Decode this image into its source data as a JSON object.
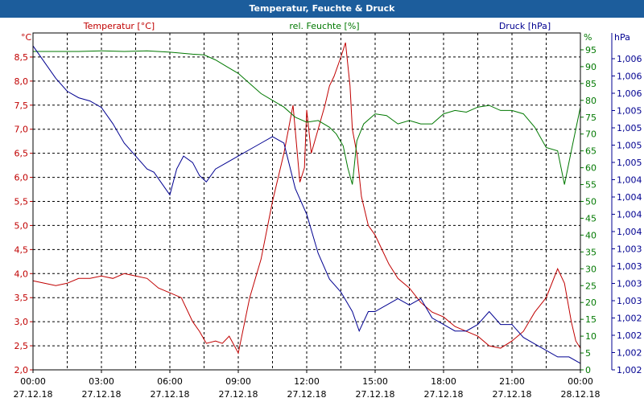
{
  "window": {
    "title": "Temperatur, Feuchte & Druck"
  },
  "colors": {
    "titlebar": "#1c5d9c",
    "temp": "#c00000",
    "hum": "#007800",
    "press": "#000090",
    "grid": "#000000"
  },
  "chart_data": {
    "type": "line",
    "x_ticks": [
      "00:00",
      "03:00",
      "06:00",
      "09:00",
      "12:00",
      "15:00",
      "18:00",
      "21:00",
      "00:00"
    ],
    "x_dates": [
      "27.12.18",
      "27.12.18",
      "27.12.18",
      "27.12.18",
      "27.12.18",
      "27.12.18",
      "27.12.18",
      "27.12.18",
      "28.12.18"
    ],
    "x_hours_range": [
      0,
      24
    ],
    "grid": true,
    "axes": {
      "temp": {
        "unit": "°C",
        "ylim": [
          2.0,
          9.0
        ],
        "ticks": [
          "2,0",
          "2,5",
          "3,0",
          "3,5",
          "4,0",
          "4,5",
          "5,0",
          "5,5",
          "6,0",
          "6,5",
          "7,0",
          "7,5",
          "8,0",
          "8,5"
        ]
      },
      "hum": {
        "unit": "%",
        "ylim": [
          0,
          100
        ],
        "ticks": [
          "0",
          "5",
          "10",
          "15",
          "20",
          "25",
          "30",
          "35",
          "40",
          "45",
          "50",
          "55",
          "60",
          "65",
          "70",
          "75",
          "80",
          "85",
          "90",
          "95"
        ]
      },
      "press": {
        "unit": "hPa",
        "ticks": [
          "1,002",
          "1,002",
          "1,002",
          "1,002",
          "1,003",
          "1,003",
          "1,003",
          "1,003",
          "1,004",
          "1,004",
          "1,004",
          "1,004",
          "1,005",
          "1,005",
          "1,005",
          "1,005",
          "1,006",
          "1,006",
          "1,006"
        ]
      }
    },
    "series": [
      {
        "name": "Temperatur [°C]",
        "axis": "temp",
        "x": [
          0,
          0.5,
          1,
          1.5,
          2,
          2.5,
          3,
          3.5,
          4,
          4.5,
          5,
          5.5,
          6,
          6.5,
          7,
          7.3,
          7.6,
          8,
          8.3,
          8.6,
          9,
          9.5,
          10,
          10.5,
          11,
          11.4,
          11.7,
          11.9,
          12,
          12.2,
          12.5,
          12.8,
          13,
          13.2,
          13.5,
          13.7,
          13.9,
          14,
          14.2,
          14.4,
          14.7,
          15,
          15.3,
          15.6,
          16,
          16.5,
          17,
          17.5,
          18,
          18.5,
          19,
          19.5,
          20,
          20.5,
          21,
          21.5,
          22,
          22.5,
          23,
          23.3,
          23.6,
          23.8,
          24
        ],
        "values": [
          3.85,
          3.8,
          3.75,
          3.8,
          3.9,
          3.9,
          3.95,
          3.9,
          4.0,
          3.95,
          3.9,
          3.7,
          3.6,
          3.5,
          3.0,
          2.8,
          2.55,
          2.6,
          2.55,
          2.7,
          2.35,
          3.5,
          4.3,
          5.5,
          6.5,
          7.5,
          5.9,
          6.2,
          7.4,
          6.5,
          7.0,
          7.5,
          7.9,
          8.1,
          8.5,
          8.8,
          7.9,
          7.0,
          6.5,
          5.6,
          5.0,
          4.8,
          4.5,
          4.2,
          3.9,
          3.7,
          3.4,
          3.2,
          3.1,
          2.9,
          2.8,
          2.7,
          2.5,
          2.45,
          2.6,
          2.8,
          3.2,
          3.5,
          4.1,
          3.8,
          3.0,
          2.6,
          2.45
        ]
      },
      {
        "name": "rel. Feuchte [%]",
        "axis": "hum",
        "x": [
          0,
          0.5,
          1,
          2,
          3,
          4,
          5,
          6,
          6.5,
          7,
          7.5,
          8,
          8.5,
          9,
          9.5,
          10,
          10.5,
          11,
          11.5,
          12,
          12.5,
          13,
          13.3,
          13.6,
          13.8,
          14,
          14.2,
          14.5,
          15,
          15.5,
          16,
          16.5,
          17,
          17.5,
          18,
          18.5,
          19,
          19.5,
          20,
          20.5,
          21,
          21.5,
          22,
          22.5,
          23,
          23.3,
          23.6,
          24
        ],
        "values": [
          94.5,
          94.5,
          94.5,
          94.5,
          94.7,
          94.5,
          94.7,
          94.3,
          94.0,
          93.7,
          93.5,
          92.0,
          90.0,
          88.0,
          85.0,
          82.0,
          80.0,
          78.0,
          75.0,
          73.5,
          74.0,
          72.0,
          70.0,
          66.5,
          60.0,
          55.0,
          68.0,
          73.0,
          76.0,
          75.5,
          73.0,
          74.0,
          73.0,
          73.0,
          76.0,
          77.0,
          76.5,
          78.0,
          78.5,
          77.0,
          77.0,
          76.0,
          72.0,
          66.0,
          65.0,
          55.0,
          65.0,
          78.0
        ]
      },
      {
        "name": "Druck [hPa]",
        "axis": "press",
        "x": [
          0,
          0.5,
          1,
          1.5,
          2,
          2.5,
          3,
          3.5,
          4,
          4.5,
          5,
          5.3,
          5.6,
          6,
          6.3,
          6.6,
          7,
          7.3,
          7.6,
          8,
          8.5,
          9,
          9.5,
          10,
          10.5,
          11,
          11.5,
          12,
          12.5,
          13,
          13.5,
          14,
          14.3,
          14.7,
          15,
          15.5,
          16,
          16.5,
          17,
          17.5,
          18,
          18.5,
          19,
          19.5,
          20,
          20.5,
          21,
          21.5,
          22,
          22.5,
          23,
          23.5,
          24
        ],
        "values": [
          1.006,
          1.00575,
          1.0055,
          1.0053,
          1.0052,
          1.00515,
          1.00505,
          1.0048,
          1.0045,
          1.0043,
          1.0041,
          1.00405,
          1.0039,
          1.0037,
          1.0041,
          1.0043,
          1.0042,
          1.004,
          1.0039,
          1.0041,
          1.0042,
          1.0043,
          1.0044,
          1.0045,
          1.0046,
          1.0045,
          1.0038,
          1.0034,
          1.0028,
          1.0024,
          1.0022,
          1.0019,
          1.0016,
          1.0019,
          1.0019,
          1.002,
          1.0021,
          1.002,
          1.0021,
          1.0018,
          1.0017,
          1.0016,
          1.0016,
          1.0017,
          1.0019,
          1.0017,
          1.0017,
          1.0015,
          1.0014,
          1.0013,
          1.0012,
          1.0012,
          1.0011
        ]
      }
    ]
  }
}
